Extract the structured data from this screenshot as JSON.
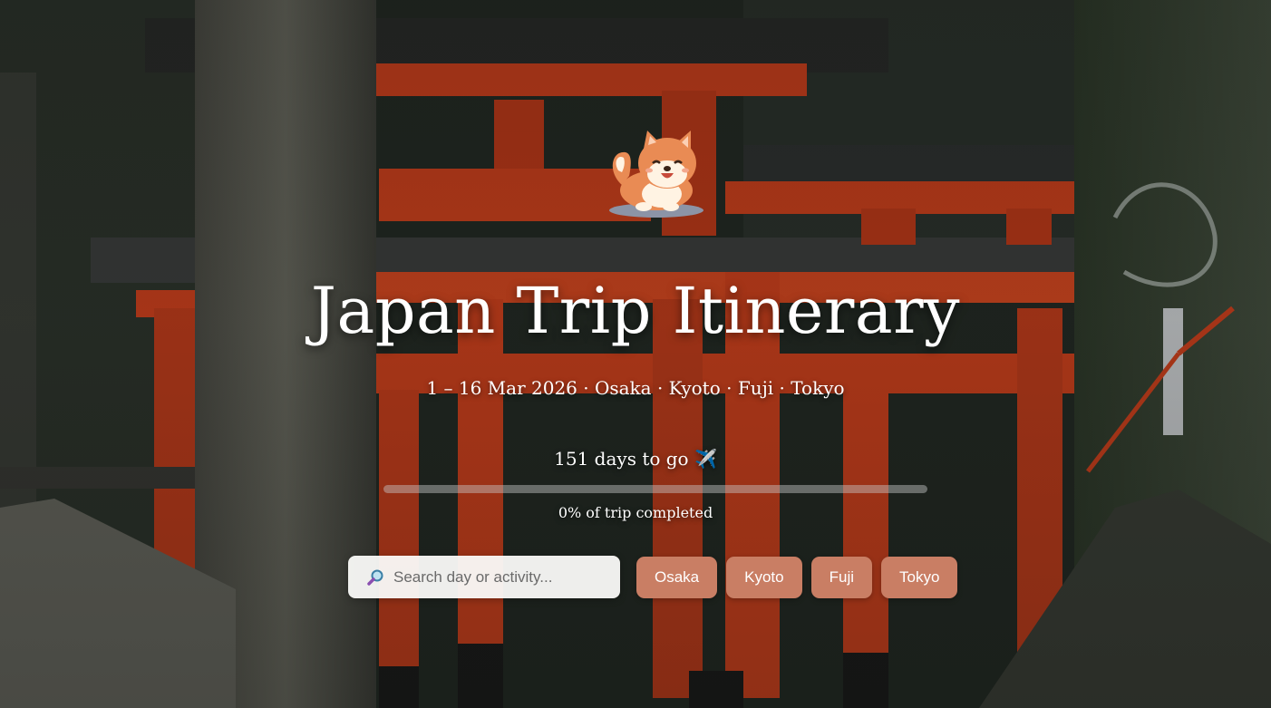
{
  "hero": {
    "title": "Japan Trip Itinerary",
    "subtitle": "1 – 16 Mar 2026 · Osaka · Kyoto · Fuji · Tokyo",
    "countdown": "151 days to go ✈️",
    "progress": {
      "fraction": 0.0,
      "label": "0% of trip completed"
    },
    "mascot_icon": "shiba-dog-icon",
    "background": "torii-gates-photo"
  },
  "search": {
    "icon": "magnifier-icon",
    "placeholder": "Search day or activity...",
    "value": ""
  },
  "filters": [
    {
      "label": "Osaka"
    },
    {
      "label": "Kyoto"
    },
    {
      "label": "Fuji"
    },
    {
      "label": "Tokyo"
    }
  ],
  "colors": {
    "chip": "#c97e64",
    "torii": "#d9421c",
    "progress_fill": "#e9a08a"
  }
}
